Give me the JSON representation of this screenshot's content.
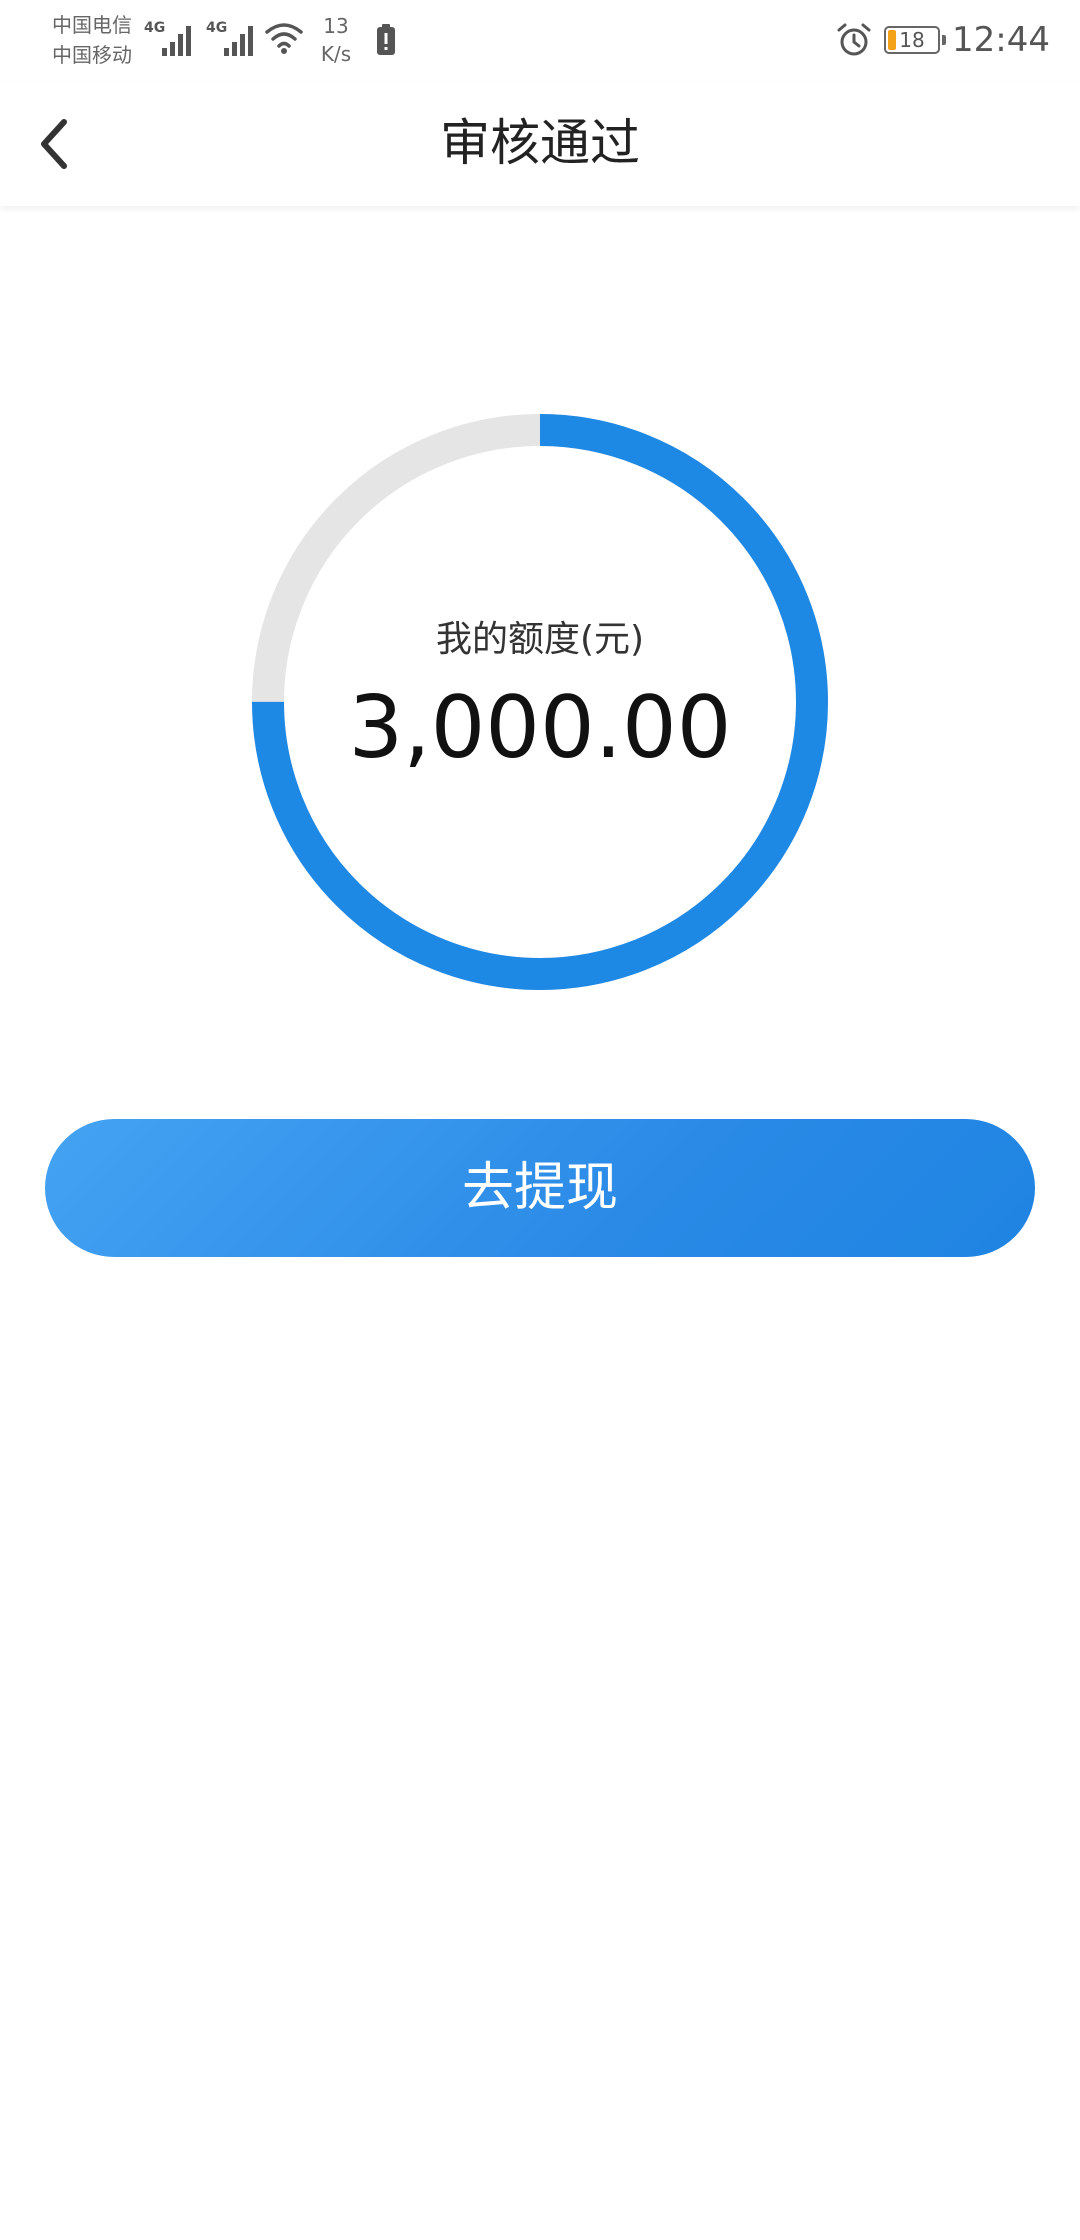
{
  "status_bar": {
    "carrier_1": "中国电信",
    "carrier_2": "中国移动",
    "network_1": "4G",
    "network_2": "4G",
    "speed_value": "13",
    "speed_unit": "K/s",
    "battery_level": "18",
    "time": "12:44",
    "icons": [
      "signal-icon",
      "wifi-icon",
      "battery-alert-icon",
      "alarm-icon",
      "battery-icon"
    ]
  },
  "header": {
    "title": "审核通过",
    "back_icon": "chevron-left-icon"
  },
  "quota": {
    "label": "我的额度(元)",
    "amount": "3,000.00",
    "progress_fraction": 0.75,
    "ring_color": "#1e88e5",
    "track_color": "#e5e5e5"
  },
  "actions": {
    "withdraw_label": "去提现",
    "button_color": "#2a8ae6"
  }
}
